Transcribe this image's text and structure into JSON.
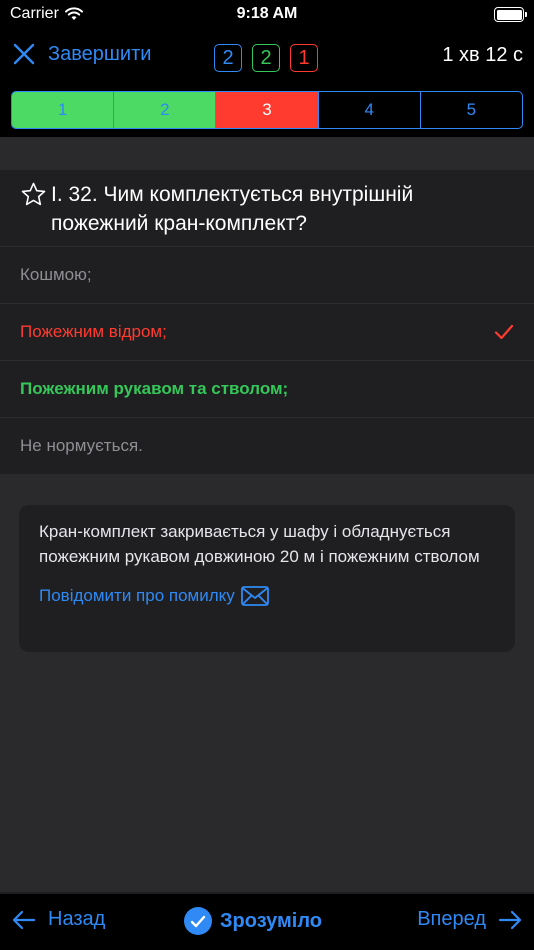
{
  "status": {
    "carrier": "Carrier",
    "time": "9:18 AM"
  },
  "nav": {
    "close_label": "Завершити",
    "counters": {
      "answered": "2",
      "correct": "2",
      "wrong": "1"
    },
    "timer": "1 хв 12 с"
  },
  "progress": {
    "segments": [
      {
        "label": "1",
        "state": "correct"
      },
      {
        "label": "2",
        "state": "correct"
      },
      {
        "label": "3",
        "state": "wrong"
      },
      {
        "label": "4",
        "state": "unanswered"
      },
      {
        "label": "5",
        "state": "unanswered"
      }
    ]
  },
  "question": {
    "text": "І. 32. Чим комплектується внутрішній пожежний кран-комплект?",
    "answers": [
      {
        "text": "Кошмою;",
        "state": "neutral"
      },
      {
        "text": "Пожежним відром;",
        "state": "selected-wrong"
      },
      {
        "text": "Пожежним рукавом та стволом;",
        "state": "correct"
      },
      {
        "text": "Не нормується.",
        "state": "neutral"
      }
    ]
  },
  "explanation": {
    "text": "Кран-комплект закривається у шафу і обладнується пожежним рукавом довжиною 20 м і пожежним стволом",
    "report_label": "Повідомити про помилку"
  },
  "toolbar": {
    "back_label": "Назад",
    "ok_label": "Зрозуміло",
    "next_label": "Вперед"
  },
  "colors": {
    "accent": "#2f8af5",
    "correct": "#35c759",
    "wrong": "#ff3b30",
    "background": "#1f1f21"
  },
  "icons": {
    "close": "close-icon",
    "star": "star-icon",
    "check": "checkmark-icon",
    "mail": "envelope-icon",
    "back": "arrow-left-icon",
    "next": "arrow-right-icon",
    "ok": "checkmark-circle-icon"
  }
}
